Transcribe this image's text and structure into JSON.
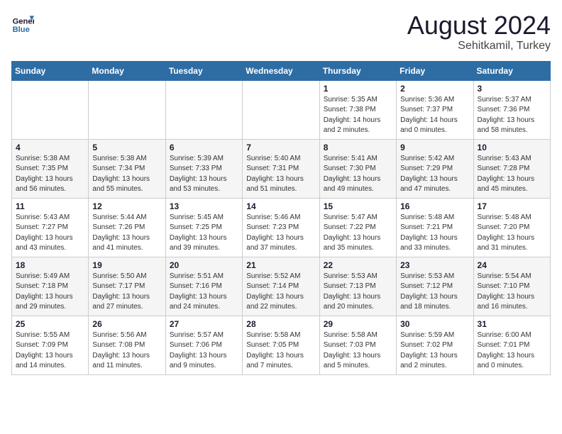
{
  "header": {
    "logo_line1": "General",
    "logo_line2": "Blue",
    "month_year": "August 2024",
    "location": "Sehitkamil, Turkey"
  },
  "days_of_week": [
    "Sunday",
    "Monday",
    "Tuesday",
    "Wednesday",
    "Thursday",
    "Friday",
    "Saturday"
  ],
  "weeks": [
    [
      {
        "day": "",
        "info": ""
      },
      {
        "day": "",
        "info": ""
      },
      {
        "day": "",
        "info": ""
      },
      {
        "day": "",
        "info": ""
      },
      {
        "day": "1",
        "info": "Sunrise: 5:35 AM\nSunset: 7:38 PM\nDaylight: 14 hours\nand 2 minutes."
      },
      {
        "day": "2",
        "info": "Sunrise: 5:36 AM\nSunset: 7:37 PM\nDaylight: 14 hours\nand 0 minutes."
      },
      {
        "day": "3",
        "info": "Sunrise: 5:37 AM\nSunset: 7:36 PM\nDaylight: 13 hours\nand 58 minutes."
      }
    ],
    [
      {
        "day": "4",
        "info": "Sunrise: 5:38 AM\nSunset: 7:35 PM\nDaylight: 13 hours\nand 56 minutes."
      },
      {
        "day": "5",
        "info": "Sunrise: 5:38 AM\nSunset: 7:34 PM\nDaylight: 13 hours\nand 55 minutes."
      },
      {
        "day": "6",
        "info": "Sunrise: 5:39 AM\nSunset: 7:33 PM\nDaylight: 13 hours\nand 53 minutes."
      },
      {
        "day": "7",
        "info": "Sunrise: 5:40 AM\nSunset: 7:31 PM\nDaylight: 13 hours\nand 51 minutes."
      },
      {
        "day": "8",
        "info": "Sunrise: 5:41 AM\nSunset: 7:30 PM\nDaylight: 13 hours\nand 49 minutes."
      },
      {
        "day": "9",
        "info": "Sunrise: 5:42 AM\nSunset: 7:29 PM\nDaylight: 13 hours\nand 47 minutes."
      },
      {
        "day": "10",
        "info": "Sunrise: 5:43 AM\nSunset: 7:28 PM\nDaylight: 13 hours\nand 45 minutes."
      }
    ],
    [
      {
        "day": "11",
        "info": "Sunrise: 5:43 AM\nSunset: 7:27 PM\nDaylight: 13 hours\nand 43 minutes."
      },
      {
        "day": "12",
        "info": "Sunrise: 5:44 AM\nSunset: 7:26 PM\nDaylight: 13 hours\nand 41 minutes."
      },
      {
        "day": "13",
        "info": "Sunrise: 5:45 AM\nSunset: 7:25 PM\nDaylight: 13 hours\nand 39 minutes."
      },
      {
        "day": "14",
        "info": "Sunrise: 5:46 AM\nSunset: 7:23 PM\nDaylight: 13 hours\nand 37 minutes."
      },
      {
        "day": "15",
        "info": "Sunrise: 5:47 AM\nSunset: 7:22 PM\nDaylight: 13 hours\nand 35 minutes."
      },
      {
        "day": "16",
        "info": "Sunrise: 5:48 AM\nSunset: 7:21 PM\nDaylight: 13 hours\nand 33 minutes."
      },
      {
        "day": "17",
        "info": "Sunrise: 5:48 AM\nSunset: 7:20 PM\nDaylight: 13 hours\nand 31 minutes."
      }
    ],
    [
      {
        "day": "18",
        "info": "Sunrise: 5:49 AM\nSunset: 7:18 PM\nDaylight: 13 hours\nand 29 minutes."
      },
      {
        "day": "19",
        "info": "Sunrise: 5:50 AM\nSunset: 7:17 PM\nDaylight: 13 hours\nand 27 minutes."
      },
      {
        "day": "20",
        "info": "Sunrise: 5:51 AM\nSunset: 7:16 PM\nDaylight: 13 hours\nand 24 minutes."
      },
      {
        "day": "21",
        "info": "Sunrise: 5:52 AM\nSunset: 7:14 PM\nDaylight: 13 hours\nand 22 minutes."
      },
      {
        "day": "22",
        "info": "Sunrise: 5:53 AM\nSunset: 7:13 PM\nDaylight: 13 hours\nand 20 minutes."
      },
      {
        "day": "23",
        "info": "Sunrise: 5:53 AM\nSunset: 7:12 PM\nDaylight: 13 hours\nand 18 minutes."
      },
      {
        "day": "24",
        "info": "Sunrise: 5:54 AM\nSunset: 7:10 PM\nDaylight: 13 hours\nand 16 minutes."
      }
    ],
    [
      {
        "day": "25",
        "info": "Sunrise: 5:55 AM\nSunset: 7:09 PM\nDaylight: 13 hours\nand 14 minutes."
      },
      {
        "day": "26",
        "info": "Sunrise: 5:56 AM\nSunset: 7:08 PM\nDaylight: 13 hours\nand 11 minutes."
      },
      {
        "day": "27",
        "info": "Sunrise: 5:57 AM\nSunset: 7:06 PM\nDaylight: 13 hours\nand 9 minutes."
      },
      {
        "day": "28",
        "info": "Sunrise: 5:58 AM\nSunset: 7:05 PM\nDaylight: 13 hours\nand 7 minutes."
      },
      {
        "day": "29",
        "info": "Sunrise: 5:58 AM\nSunset: 7:03 PM\nDaylight: 13 hours\nand 5 minutes."
      },
      {
        "day": "30",
        "info": "Sunrise: 5:59 AM\nSunset: 7:02 PM\nDaylight: 13 hours\nand 2 minutes."
      },
      {
        "day": "31",
        "info": "Sunrise: 6:00 AM\nSunset: 7:01 PM\nDaylight: 13 hours\nand 0 minutes."
      }
    ]
  ]
}
